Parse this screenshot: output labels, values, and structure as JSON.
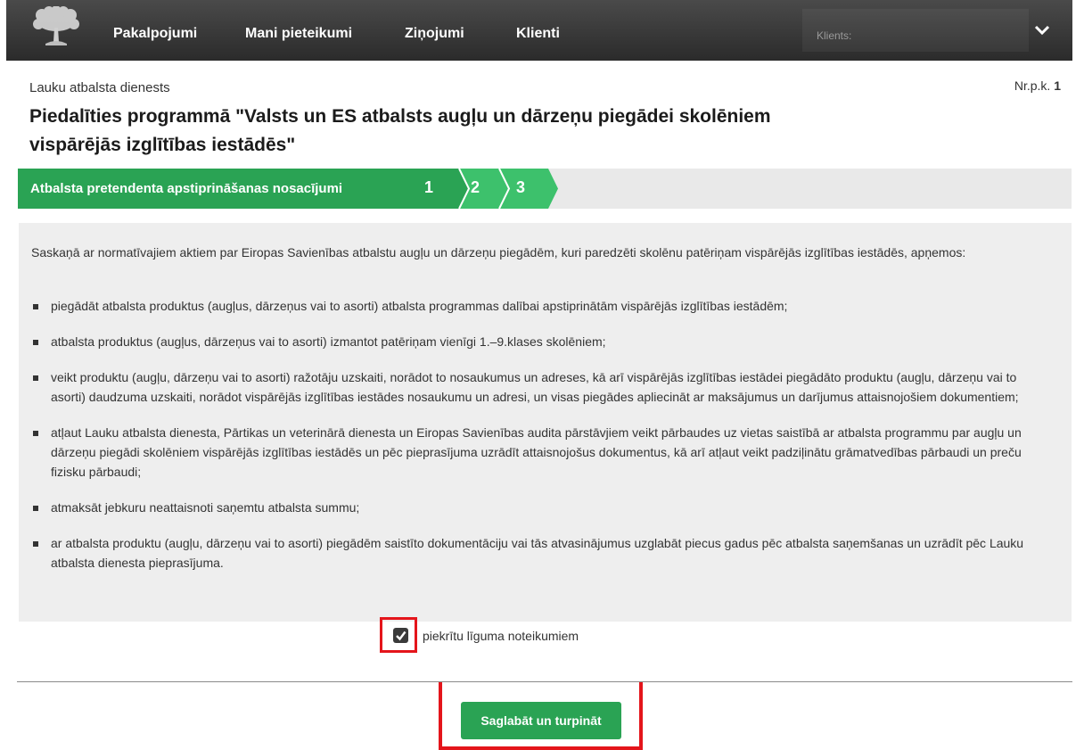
{
  "nav": {
    "items": [
      "Pakalpojumi",
      "Mani pieteikumi",
      "Ziņojumi",
      "Klienti"
    ],
    "client_label": "Klients:"
  },
  "header": {
    "org": "Lauku atbalsta dienests",
    "nrpk_label": "Nr.p.k.",
    "nrpk_value": "1",
    "title": "Piedalīties programmā \"Valsts un ES atbalsts augļu un dārzeņu piegādei skolēniem vispārējās izglītības iestādēs\""
  },
  "stepper": {
    "title": "Atbalsta pretendenta apstiprināšanas nosacījumi",
    "steps": [
      "1",
      "2",
      "3"
    ],
    "colors": {
      "active": "#2aa354",
      "light": "#3dc16c",
      "background": "#e9e9e9"
    }
  },
  "content": {
    "intro": "Saskaņā ar normatīvajiem aktiem par Eiropas Savienības atbalstu augļu un dārzeņu piegādēm, kuri paredzēti skolēnu patēriņam vispārējās izglītības iestādēs, apņemos:",
    "items": [
      "piegādāt atbalsta produktus (augļus, dārzeņus vai to asorti) atbalsta programmas dalībai apstiprinātām vispārējās izglītības iestādēm;",
      "atbalsta produktus (augļus, dārzeņus vai to asorti) izmantot patēriņam vienīgi 1.–9.klases skolēniem;",
      "veikt produktu (augļu, dārzeņu vai to asorti) ražotāju uzskaiti, norādot to nosaukumus un adreses, kā arī vispārējās izglītības iestādei piegādāto produktu (augļu, dārzeņu vai to asorti) daudzuma uzskaiti, norādot vispārējās izglītības iestādes nosaukumu un adresi, un visas piegādes apliecināt ar maksājumus un darījumus attaisnojošiem dokumentiem;",
      "atļaut Lauku atbalsta dienesta, Pārtikas un veterinārā dienesta un Eiropas Savienības audita pārstāvjiem veikt pārbaudes uz vietas saistībā ar atbalsta programmu par augļu un dārzeņu piegādi skolēniem vispārējās izglītības iestādēs un pēc pieprasījuma uzrādīt attaisnojošus dokumentus, kā arī atļaut veikt padziļinātu grāmatvedības pārbaudi un preču fizisku pārbaudi;",
      "atmaksāt jebkuru neattaisnoti saņemtu atbalsta summu;",
      "ar atbalsta produktu (augļu, dārzeņu vai to asorti) piegādēm saistīto dokumentāciju vai tās atvasinājumus uzglabāt piecus gadus pēc atbalsta saņemšanas un uzrādīt pēc Lauku atbalsta dienesta pieprasījuma."
    ]
  },
  "agreement": {
    "label": "piekrītu līguma noteikumiem",
    "checked": true
  },
  "actions": {
    "save_label": "Saglabāt un turpināt"
  },
  "colors": {
    "navbar": "#333333",
    "primary_button": "#2aa354",
    "highlight": "#e4151b"
  }
}
